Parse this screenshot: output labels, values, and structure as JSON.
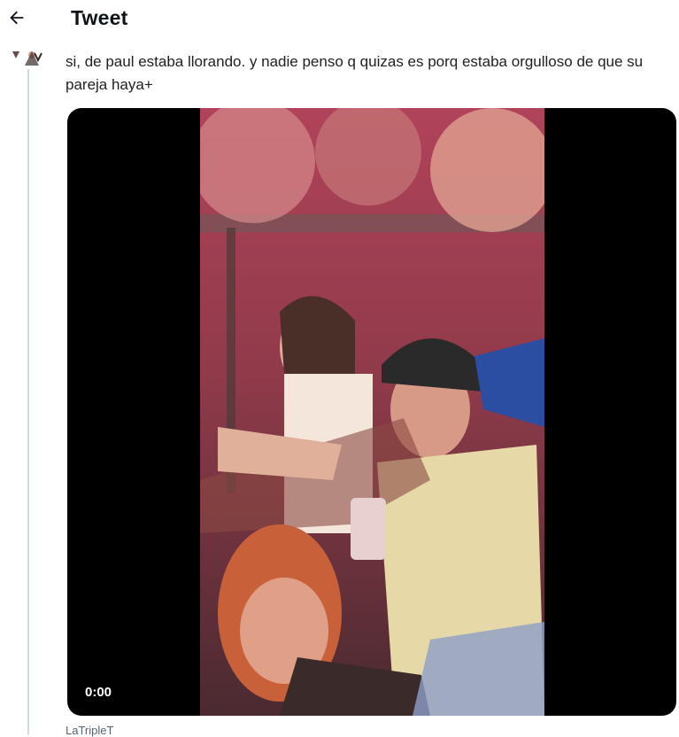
{
  "header": {
    "title": "Tweet",
    "back_icon": "arrow-left-icon"
  },
  "tweet": {
    "text": "si, de paul estaba llorando. y nadie penso q quizas es porq estaba orgulloso de que su pareja haya+"
  },
  "media": {
    "type": "video",
    "timestamp": "0:00"
  },
  "footer": {
    "text": "LaTripleT"
  },
  "colors": {
    "text": "#0f1419",
    "muted": "#536471",
    "thread_line": "#cfd9de",
    "video_bg": "#000000"
  }
}
